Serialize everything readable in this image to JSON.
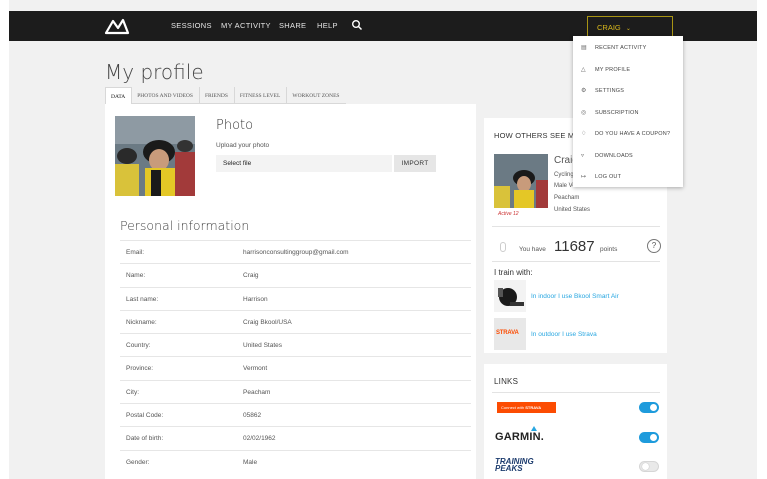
{
  "nav": {
    "items": [
      "SESSIONS",
      "MY ACTIVITY",
      "SHARE",
      "HELP"
    ],
    "user_button": "CRAIG",
    "icons": {
      "logo": "bkool-logo",
      "search": "search-icon",
      "chevron": "chevron-down-icon"
    }
  },
  "dropdown": {
    "items": [
      {
        "label": "RECENT ACTIVITY",
        "icon": "list-icon"
      },
      {
        "label": "MY PROFILE",
        "icon": "user-icon"
      },
      {
        "label": "SETTINGS",
        "icon": "gear-icon"
      },
      {
        "label": "SUBSCRIPTION",
        "icon": "badge-icon"
      },
      {
        "label": "DO YOU HAVE A COUPON?",
        "icon": "tag-icon"
      },
      {
        "label": "DOWNLOADS",
        "icon": "download-icon"
      },
      {
        "label": "LOG OUT",
        "icon": "logout-icon"
      }
    ]
  },
  "page": {
    "title": "My profile"
  },
  "tabs": [
    "DATA",
    "PHOTOS AND VIDEOS",
    "FRIENDS",
    "FITNESS LEVEL",
    "WORKOUT ZONES"
  ],
  "photo": {
    "title": "Photo",
    "upload_label": "Upload your photo",
    "file_button": "Select file",
    "import_button": "IMPORT"
  },
  "personal": {
    "title": "Personal information",
    "rows": [
      {
        "label": "Email:",
        "value": "harrisonconsultinggroup@gmail.com"
      },
      {
        "label": "Name:",
        "value": "Craig"
      },
      {
        "label": "Last name:",
        "value": "Harrison"
      },
      {
        "label": "Nickname:",
        "value": "Craig Bkool/USA"
      },
      {
        "label": "Country:",
        "value": "United States"
      },
      {
        "label": "Province:",
        "value": "Vermont"
      },
      {
        "label": "City:",
        "value": "Peacham"
      },
      {
        "label": "Postal Code:",
        "value": "05862"
      },
      {
        "label": "Date of birth:",
        "value": "02/02/1962"
      },
      {
        "label": "Gender:",
        "value": "Male"
      }
    ]
  },
  "preview": {
    "title": "HOW OTHERS SEE MY PROFILE",
    "name": "Craig H",
    "sport": "Cycling",
    "details": [
      "Male Vete",
      "Peacham",
      "United States"
    ],
    "badge": "Active 12"
  },
  "points": {
    "prefix": "You have",
    "value": "11687",
    "unit": "points",
    "help": "?"
  },
  "train": {
    "title": "I train with:",
    "items": [
      {
        "text": "In indoor I use Bkool Smart Air",
        "icon": "trainer-icon"
      },
      {
        "text": "In outdoor I use Strava",
        "logo": "STRAVA"
      }
    ]
  },
  "links": {
    "title": "LINKS",
    "strava_prefix": "Connect with",
    "strava_brand": "STRAVA",
    "garmin": "GARMIN.",
    "trainingpeaks_1": "TRAINING",
    "trainingpeaks_2": "PEAKS",
    "toggles": {
      "strava": true,
      "garmin": true,
      "trainingpeaks": false
    }
  },
  "colors": {
    "accent": "#1e9bdc",
    "link": "#29a7e1",
    "strava": "#fc4c02",
    "user_gold": "#d9b81c",
    "nav_bg": "#1c1c1c"
  }
}
